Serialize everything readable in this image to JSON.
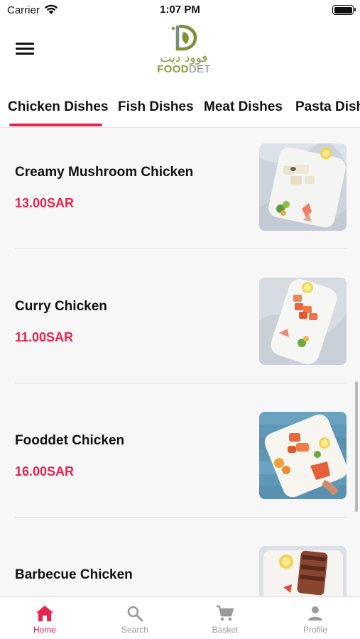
{
  "status_bar": {
    "carrier": "Carrier",
    "time": "1:07 PM",
    "battery_level": 1.0
  },
  "header": {
    "menu_icon": "hamburger-menu-icon",
    "logo": {
      "arabic_text": "فوود ديت",
      "brand_food": "FOOD",
      "brand_det": "DET"
    }
  },
  "tabs": [
    {
      "label": "Chicken Dishes",
      "active": true
    },
    {
      "label": "Fish Dishes",
      "active": false
    },
    {
      "label": "Meat Dishes",
      "active": false
    },
    {
      "label": "Pasta Dishes",
      "active": false
    }
  ],
  "items": [
    {
      "name": "Creamy Mushroom Chicken",
      "price": "13.00SAR"
    },
    {
      "name": "Curry Chicken",
      "price": "11.00SAR"
    },
    {
      "name": "Fooddet Chicken",
      "price": "16.00SAR"
    },
    {
      "name": "Barbecue Chicken",
      "price": ""
    }
  ],
  "bottom_nav": [
    {
      "label": "Home",
      "icon": "home-icon",
      "active": true
    },
    {
      "label": "Search",
      "icon": "search-icon",
      "active": false
    },
    {
      "label": "Basket",
      "icon": "cart-icon",
      "active": false
    },
    {
      "label": "Profile",
      "icon": "person-icon",
      "active": false
    }
  ],
  "colors": {
    "accent": "#e8234e",
    "inactive": "#9a9a9a",
    "brand_green": "#8a9a3c"
  }
}
